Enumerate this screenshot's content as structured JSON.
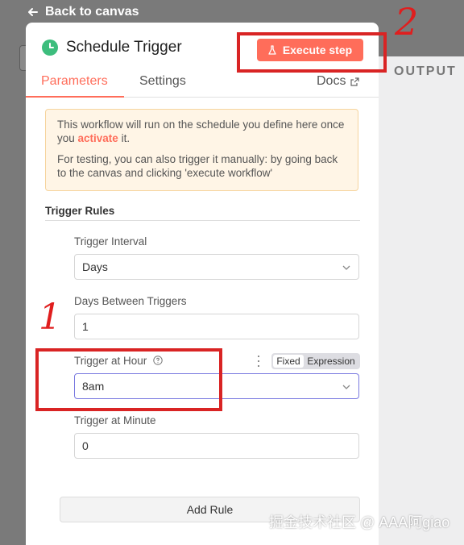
{
  "navigation": {
    "back_label": "Back to canvas"
  },
  "output_panel": {
    "label": "OUTPUT"
  },
  "node": {
    "title": "Schedule Trigger",
    "icon": "clock-icon",
    "execute_label": "Execute step",
    "tabs": [
      {
        "label": "Parameters",
        "active": true
      },
      {
        "label": "Settings",
        "active": false
      }
    ],
    "docs_label": "Docs"
  },
  "notice": {
    "line1_prefix": "This workflow will run on the schedule you define here once you ",
    "activate_link": "activate",
    "line1_suffix": " it.",
    "line2": "For testing, you can also trigger it manually: by going back to the canvas and clicking 'execute workflow'"
  },
  "trigger_rules": {
    "title": "Trigger Rules",
    "fields": [
      {
        "label": "Trigger Interval",
        "value": "Days",
        "type": "select"
      },
      {
        "label": "Days Between Triggers",
        "value": "1",
        "type": "number"
      },
      {
        "label": "Trigger at Hour",
        "value": "8am",
        "type": "select",
        "mode_fixed": "Fixed",
        "mode_expression": "Expression"
      },
      {
        "label": "Trigger at Minute",
        "value": "0",
        "type": "number"
      }
    ],
    "add_rule_label": "Add Rule"
  },
  "annotations": {
    "marker_1": "1",
    "marker_2": "2"
  },
  "watermark": "掘金技术社区 @ AAA阿giao",
  "colors": {
    "accent": "#ff6d5a",
    "trigger_green": "#3dbd7d",
    "annotation_red": "#d92424",
    "notice_bg": "#fff5e6"
  }
}
